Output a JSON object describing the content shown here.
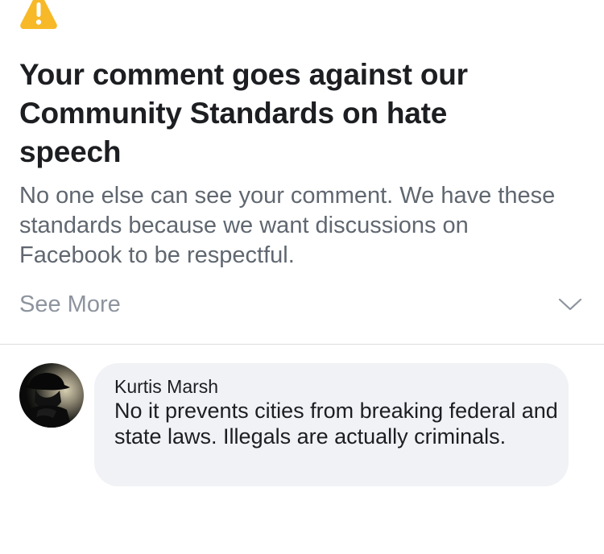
{
  "notice": {
    "icon": "warning-triangle-icon",
    "icon_color": "#f7b928",
    "title": "Your comment goes against our Community Standards on hate speech",
    "body": "No one else can see your comment. We have these standards because we want discussions on Facebook to be respectful.",
    "see_more_label": "See More",
    "expand_icon": "chevron-down-icon"
  },
  "comment": {
    "author": "Kurtis Marsh",
    "text": "No it prevents cities from breaking federal and state laws. Illegals are actually criminals.",
    "avatar_icon": "profile-avatar"
  },
  "colors": {
    "title": "#1c1e21",
    "body": "#606770",
    "muted": "#8d949e",
    "bubble": "#f0f2f5",
    "divider": "#dadde1"
  }
}
